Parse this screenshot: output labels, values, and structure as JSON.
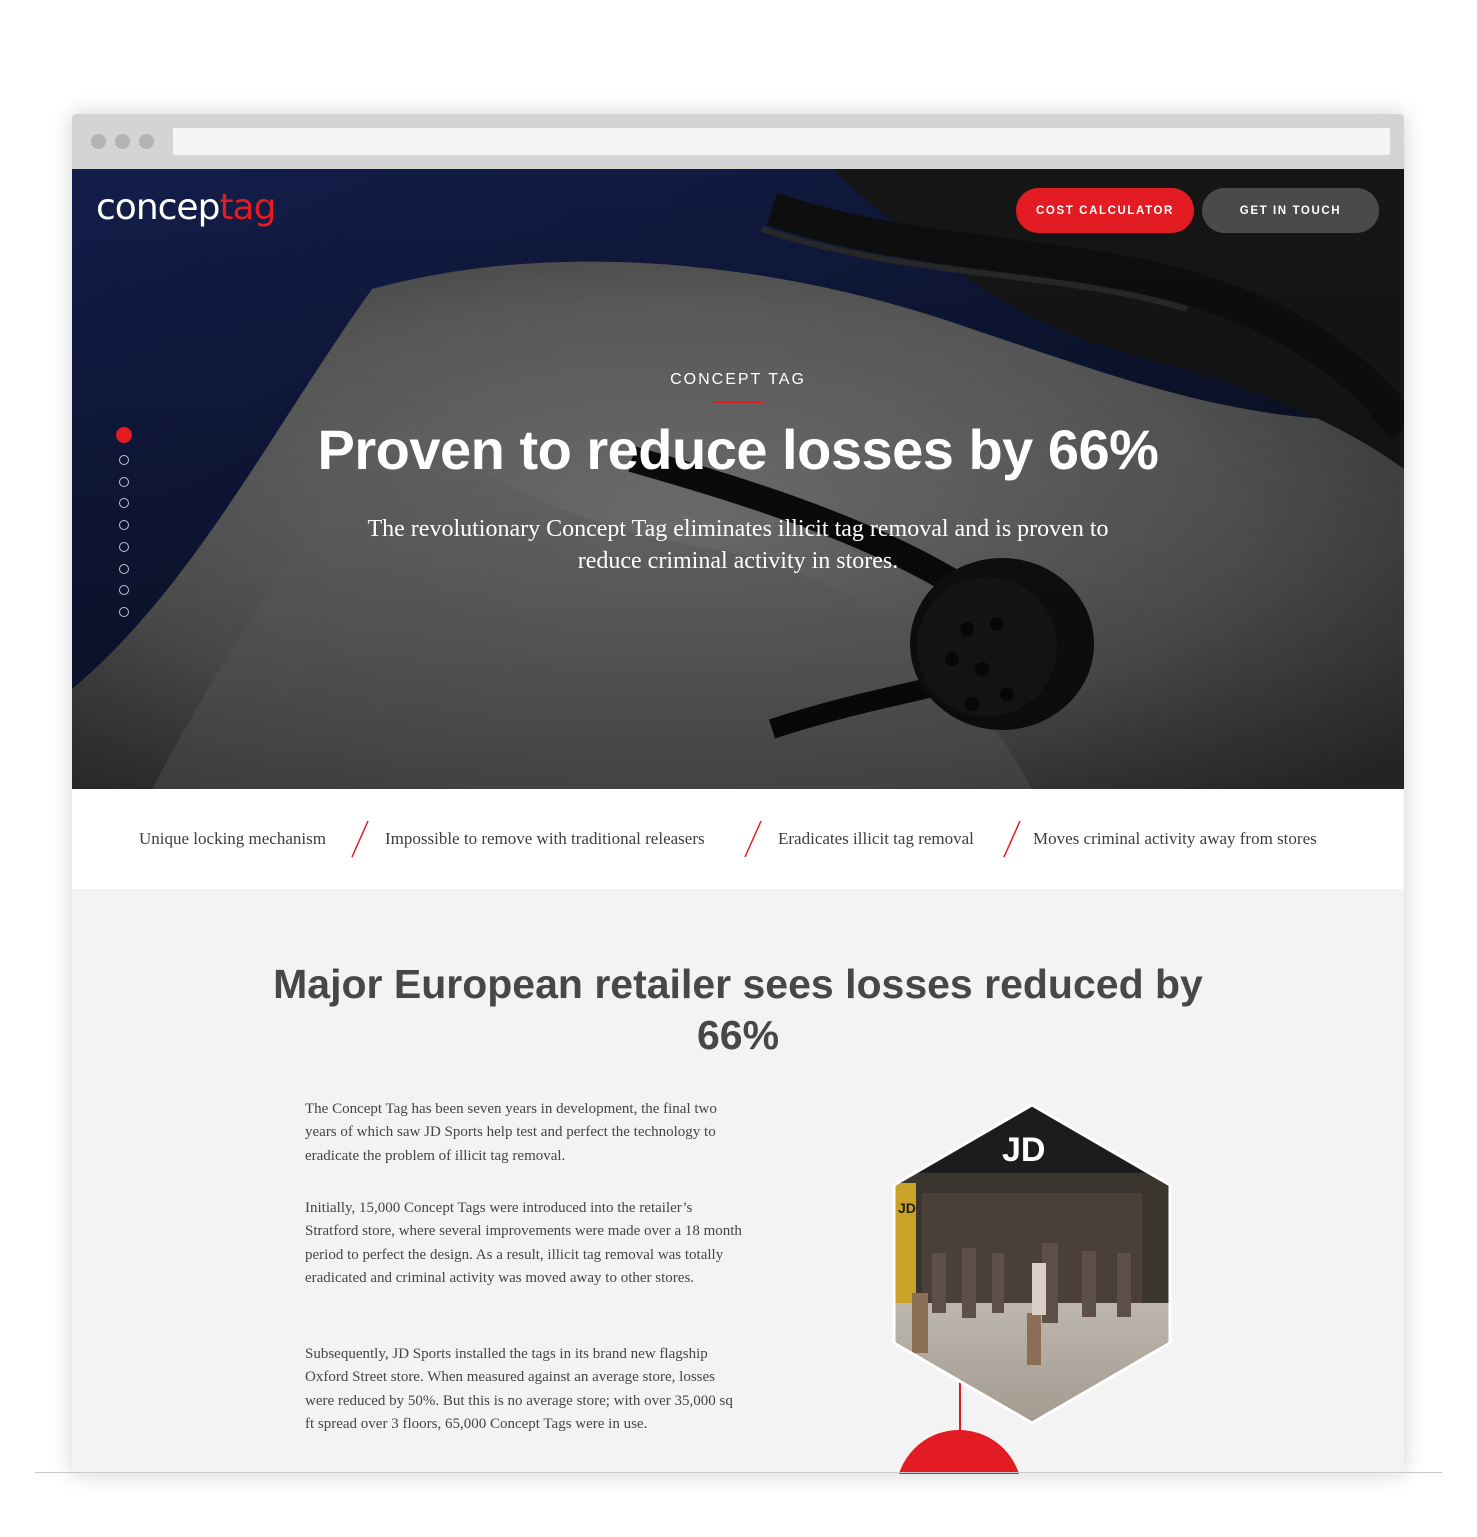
{
  "header": {
    "logo_part1": "concep",
    "logo_part2": "tag",
    "cost_calculator_label": "COST CALCULATOR",
    "get_in_touch_label": "GET IN TOUCH"
  },
  "hero": {
    "eyebrow": "CONCEPT TAG",
    "title": "Proven to reduce losses by 66%",
    "subtitle": "The revolutionary Concept Tag eliminates illicit tag removal and is proven to reduce criminal activity in stores.",
    "slide_count": 9,
    "active_slide": 1
  },
  "features": [
    "Unique locking mechanism",
    "Impossible to remove with traditional releasers",
    "Eradicates illicit tag removal",
    "Moves criminal activity away from stores"
  ],
  "case_study": {
    "title": "Major European retailer sees losses reduced by 66%",
    "paragraphs": [
      "The Concept Tag has been seven years in development, the final two years of which saw JD Sports help test and perfect the technology to eradicate the problem of illicit tag removal.",
      "Initially, 15,000 Concept Tags were introduced into the retailer’s Stratford store, where several improvements were made over a 18 month period to perfect the design. As a result, illicit tag removal was totally eradicated and criminal activity was moved away to other stores.",
      "Subsequently, JD Sports installed the tags in its brand new flagship Oxford Street store. When measured against an average store, losses were reduced by 50%. But this is no average store; with over 35,000 sq ft spread over 3 floors, 65,000 Concept Tags were in use."
    ],
    "store_sign": "JD"
  },
  "colors": {
    "accent": "#e31b23",
    "dark_button": "#4a4a4a",
    "section_bg": "#f3f3f3",
    "heading": "#474747"
  }
}
